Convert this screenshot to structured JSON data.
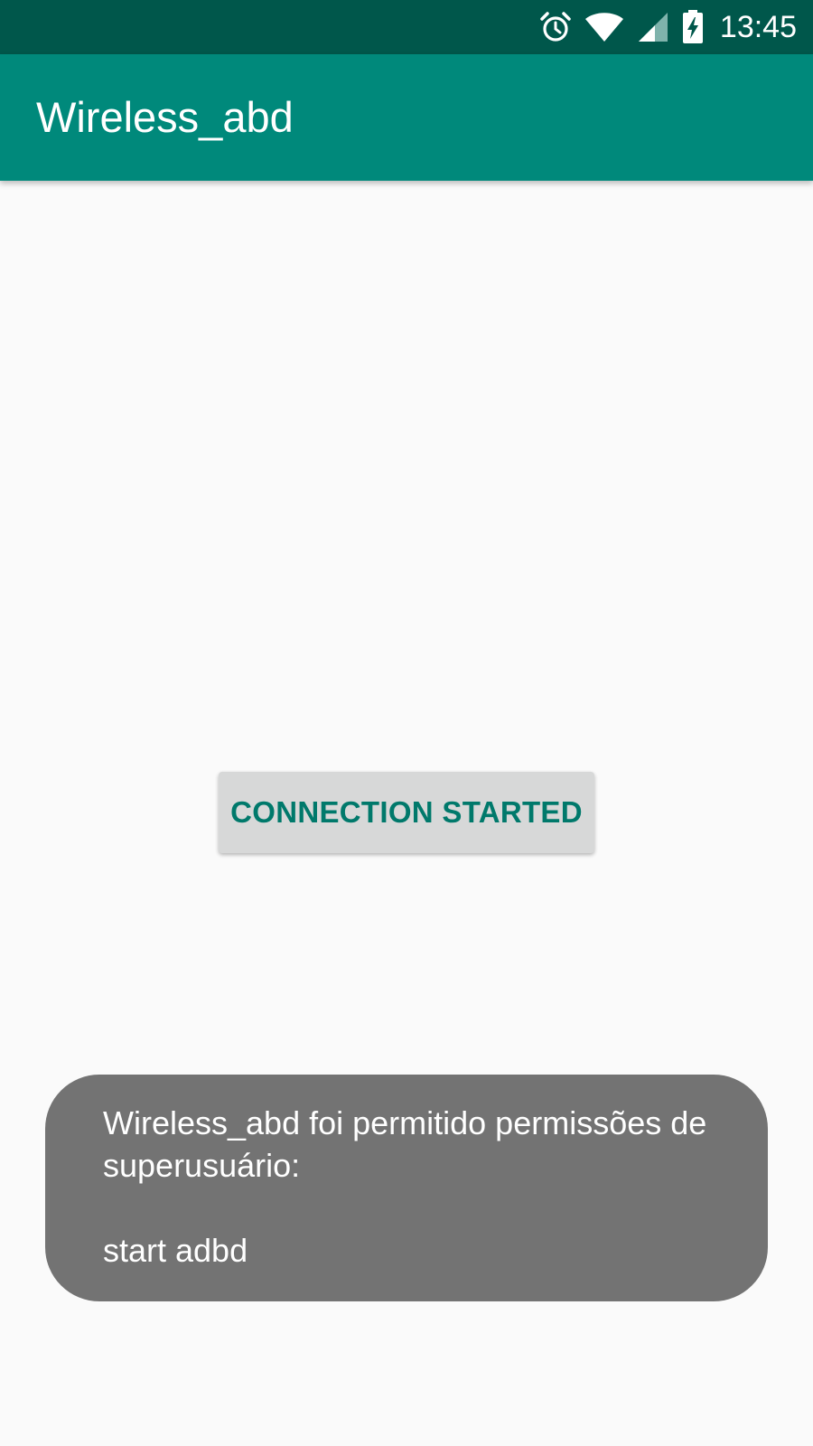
{
  "status_bar": {
    "time": "13:45",
    "icons": [
      "alarm-icon",
      "wifi-icon",
      "cell-signal-icon",
      "battery-charging-icon"
    ]
  },
  "app_bar": {
    "title": "Wireless_abd"
  },
  "main": {
    "button_label": "CONNECTION STARTED"
  },
  "toast": {
    "line1": "Wireless_abd foi permitido permissões de superusuário:",
    "line2": "start adbd"
  },
  "colors": {
    "status_bar": "#00574b",
    "app_bar": "#00897b",
    "button_bg": "#d7d8d8",
    "button_text": "#00796b",
    "toast_bg": "#737373",
    "background": "#fafafa"
  }
}
